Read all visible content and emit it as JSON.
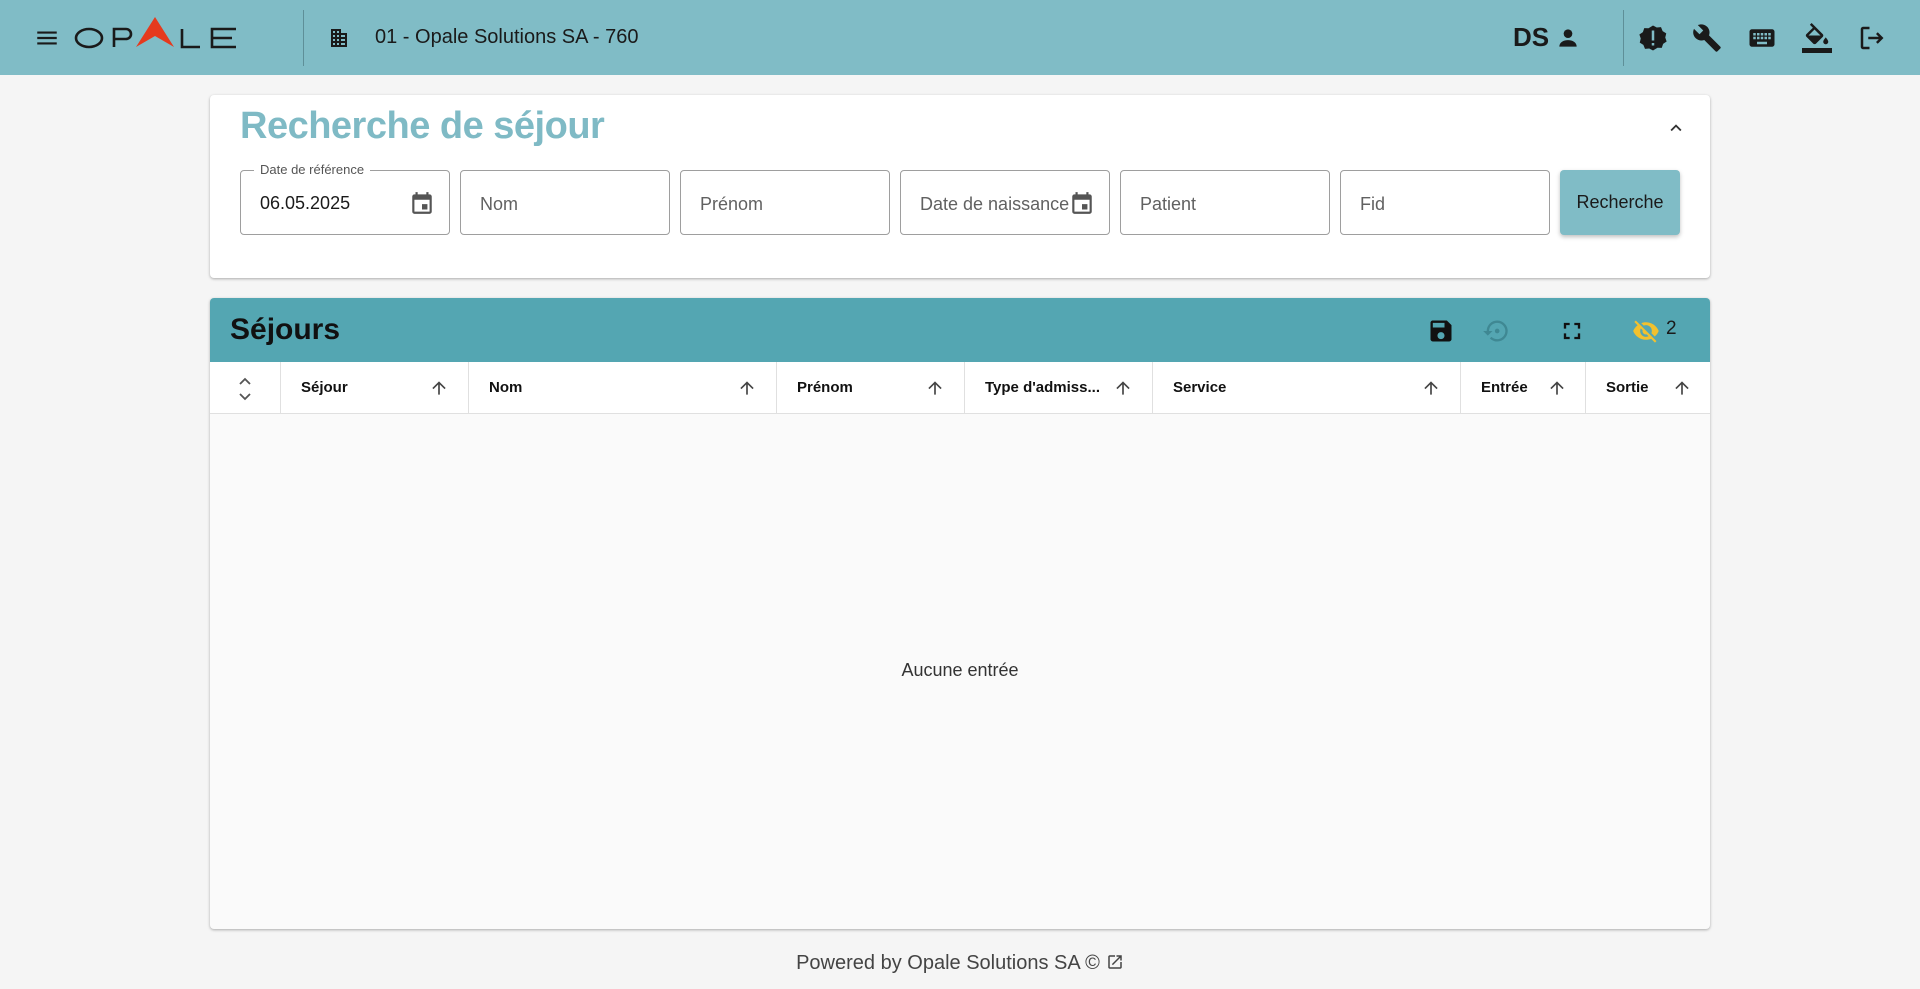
{
  "app": {
    "logo_text": "OPALE",
    "org_label": "01 -  Opale Solutions SA - 760",
    "user_initials": "DS",
    "icons": [
      "menu-icon",
      "building-icon",
      "account-icon",
      "alert-octagon-icon",
      "wrench-icon",
      "keyboard-icon",
      "format-color-fill-icon",
      "logout-icon"
    ]
  },
  "search": {
    "title": "Recherche de séjour",
    "reference_date": {
      "label": "Date de référence",
      "value": "06.05.2025"
    },
    "nom_placeholder": "Nom",
    "prenom_placeholder": "Prénom",
    "birthdate_placeholder": "Date de naissance",
    "patient_placeholder": "Patient",
    "fid_placeholder": "Fid",
    "search_button": "Recherche"
  },
  "results": {
    "title": "Séjours",
    "hidden_columns_count": "2",
    "columns": [
      "Séjour",
      "Nom",
      "Prénom",
      "Type d'admiss...",
      "Service",
      "Entrée",
      "Sortie"
    ],
    "empty_message": "Aucune entrée"
  },
  "footer": {
    "text": "Powered by Opale Solutions SA ©"
  },
  "colors": {
    "topbar": "#80bcc6",
    "results_header": "#54a6b2",
    "search_title": "#7fbac5",
    "logo_accent": "#e53a1e",
    "hidden_icon": "#f2c12e"
  }
}
